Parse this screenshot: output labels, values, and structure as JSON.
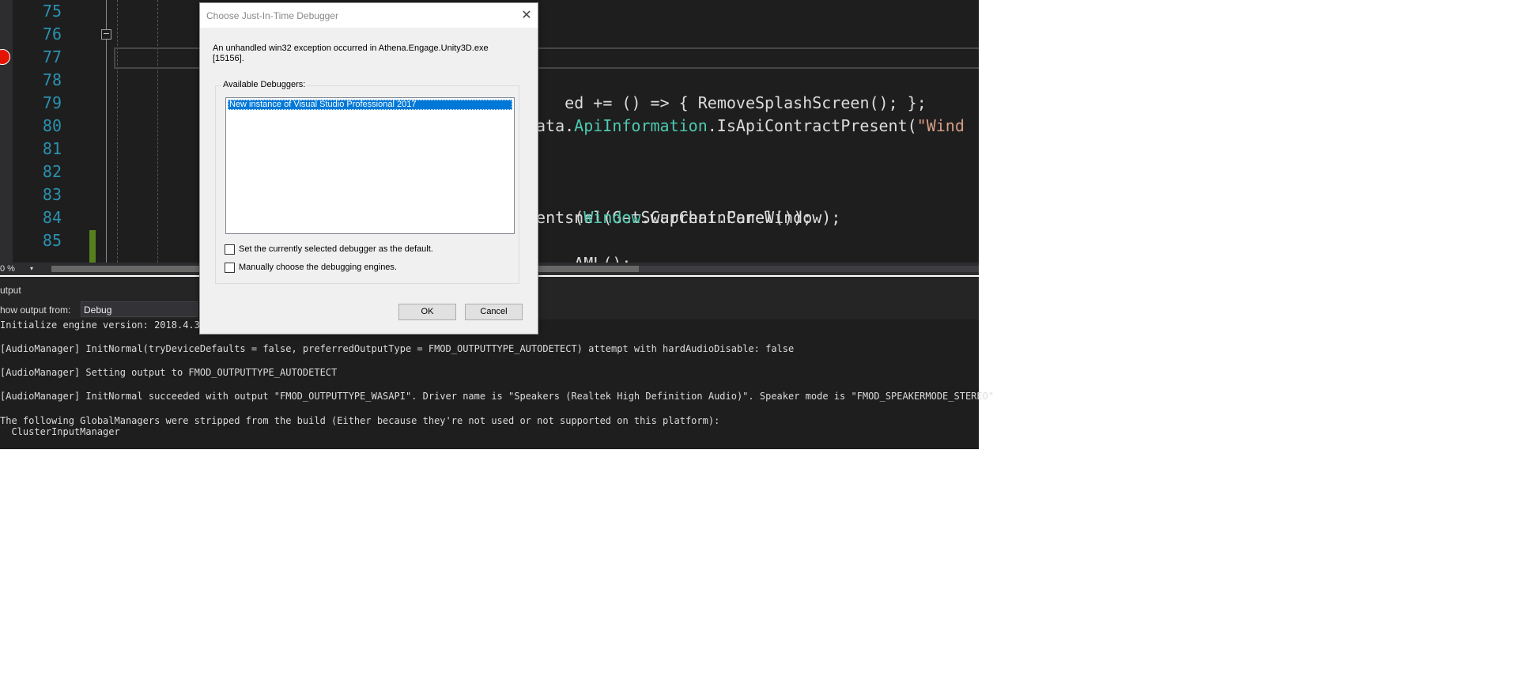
{
  "editor": {
    "line_numbers": [
      "75",
      "76",
      "77",
      "78",
      "79",
      "80",
      "81",
      "82",
      "83",
      "84",
      "85"
    ],
    "collapse_glyph": "−",
    "code": {
      "line78": "ed += () => { RemoveSplashScreen(); };",
      "line80_pre": "ata.",
      "line80_type": "ApiInformation",
      "line80_mid": ".IsApiContractPresent(",
      "line80_str": "\"Wind",
      "line83": "nel(GetSwapChainPanel());",
      "line84_pre": "vents(",
      "line84_type": "Window",
      "line84_post": ".Current.CoreWindow);",
      "line85": "AML();"
    },
    "zoom": "0 %",
    "zoom_arrow": "▾"
  },
  "output": {
    "title": "utput",
    "show_output_from_label": "how output from:",
    "source": "Debug",
    "lines": [
      "Initialize engine version: 2018.4.3",
      "[AudioManager] InitNormal(tryDeviceDefaults = false, preferredOutputType = FMOD_OUTPUTTYPE_AUTODETECT) attempt with hardAudioDisable: false",
      "[AudioManager] Setting output to FMOD_OUTPUTTYPE_AUTODETECT",
      "[AudioManager] InitNormal succeeded with output \"FMOD_OUTPUTTYPE_WASAPI\". Driver name is \"Speakers (Realtek High Definition Audio)\". Speaker mode is \"FMOD_SPEAKERMODE_STEREO\"",
      "The following GlobalManagers were stripped from the build (Either because they're not used or not supported on this platform):",
      "  ClusterInputManager"
    ]
  },
  "dialog": {
    "title": "Choose Just-In-Time Debugger",
    "close_glyph": "✕",
    "message_line1": "An unhandled win32 exception occurred in Athena.Engage.Unity3D.exe",
    "message_line2": "[15156].",
    "available_label": "Available Debuggers:",
    "debuggers": [
      "New instance of Visual Studio Professional 2017"
    ],
    "checkbox_default": "Set the currently selected debugger as the default.",
    "checkbox_manual": "Manually choose the debugging engines.",
    "ok": "OK",
    "cancel": "Cancel"
  },
  "colors": {
    "editor_bg": "#1e1e1e",
    "line_number": "#2b91af",
    "type": "#4ec9b0",
    "string": "#d69d85",
    "selection": "#0078d7",
    "breakpoint": "#e51400"
  }
}
